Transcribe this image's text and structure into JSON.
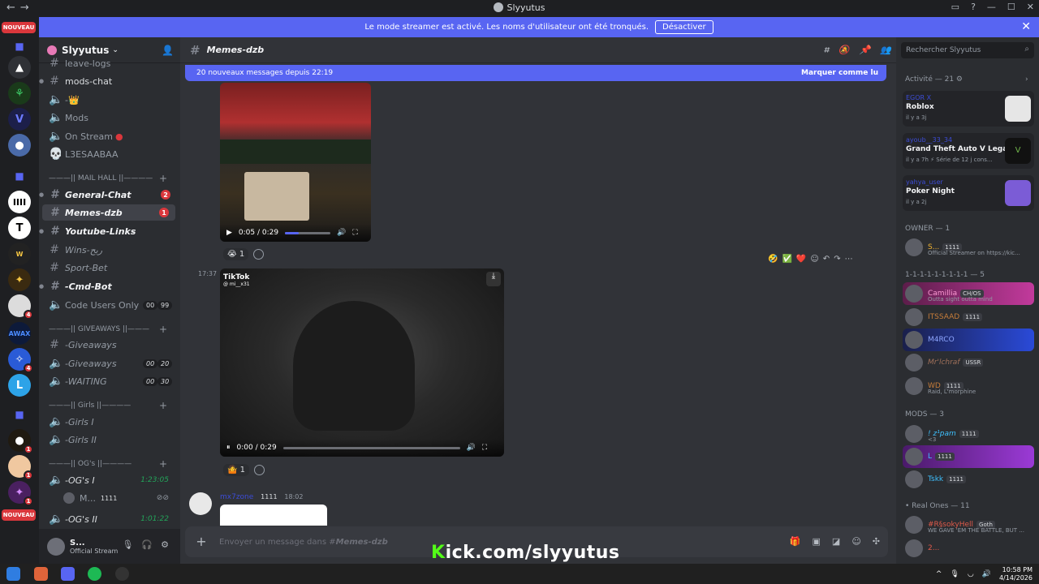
{
  "window": {
    "title": "Slyyutus",
    "nav_back": "←",
    "nav_forward": "→",
    "controls": [
      "▭",
      "?",
      "—",
      "☐",
      "✕"
    ]
  },
  "banner": {
    "text": "Le mode streamer est activé. Les noms d'utilisateur ont été tronqués.",
    "button": "Désactiver",
    "close": "✕"
  },
  "rail": {
    "nouveau_top": "NOUVEAU",
    "nouveau_bottom": "NOUVEAU",
    "badges": [
      "4",
      "4",
      "1",
      "1",
      "1"
    ]
  },
  "server": {
    "name": "Slyyutus",
    "channels": [
      {
        "name": "leave-logs"
      },
      {
        "name": "mods-chat"
      },
      {
        "name": "-👑"
      },
      {
        "name": "Mods"
      },
      {
        "name": "On Stream"
      },
      {
        "name": "L3ESAABAA"
      },
      {
        "name": "General-Chat",
        "count": "2"
      },
      {
        "name": "Memes-dzb",
        "count": "1"
      },
      {
        "name": "Youtube-Links"
      },
      {
        "name": "Wins-ربح"
      },
      {
        "name": "Sport-Bet"
      },
      {
        "name": "-Cmd-Bot"
      },
      {
        "name": "Code Users Only",
        "pill1": "00",
        "pill2": "99"
      },
      {
        "name": "-Giveaways"
      },
      {
        "name": "-Giveaways",
        "pill1": "00",
        "pill2": "20"
      },
      {
        "name": "-WAITING",
        "pill1": "00",
        "pill2": "30"
      },
      {
        "name": "-Girls I"
      },
      {
        "name": "-Girls II"
      },
      {
        "name": "-OG's I",
        "time": "1:23:05"
      },
      {
        "name": "M...",
        "tag": "1111"
      },
      {
        "name": "-OG's II",
        "time": "1:01:22"
      }
    ],
    "categories": [
      "———|| MAIL HALL ||————",
      "———|| GIVEAWAYS ||———",
      "———|| Girls ||————",
      "———|| OG's ||————"
    ]
  },
  "user": {
    "name": "S...",
    "status": "Official Stream"
  },
  "chat": {
    "channel": "Memes-dzb",
    "new_messages": "20 nouveaux messages depuis 22:19",
    "mark_read": "Marquer comme lu",
    "video1": {
      "time": "0:05 / 0:29",
      "progress": 0.3,
      "reaction_emoji": "😭",
      "reaction_count": "1"
    },
    "message2_time": "17:37",
    "video2": {
      "time": "0:00 / 0:29",
      "progress": 0.0,
      "tiktok": "TikTok",
      "tiktok_user": "@ mi__x31",
      "reaction_emoji": "🤷",
      "reaction_count": "1"
    },
    "hover_reactions": [
      "🤣",
      "✅",
      "❤️"
    ],
    "message3": {
      "author": "mx7zone",
      "tag": "1111",
      "time": "18:02"
    },
    "composer_placeholder_prefix": "Envoyer un message dans #",
    "composer_placeholder_channel": "Memes-dzb"
  },
  "members": {
    "search_placeholder": "Rechercher Slyyutus",
    "activity_header": "Activité — 21",
    "activities": [
      {
        "user": "EGOR X",
        "game": "Roblox",
        "time": "il y a 3j"
      },
      {
        "user": "ayoub__33_34",
        "game": "Grand Theft Auto V Legacy",
        "time": "il y a 7h  ⚡ Série de 12 j cons..."
      },
      {
        "user": "yahya_user",
        "game": "Poker Night",
        "time": "il y a 2j"
      }
    ],
    "owner_header": "OWNER — 1",
    "owner": {
      "name": "S...",
      "tag": "1111",
      "sub": "Official Streamer on https://kic..."
    },
    "group_header": "1-1-1-1-1-1-1-1-1 — 5",
    "group": [
      {
        "name": "Camillia",
        "tag": "CH/OS",
        "sub": "Outta sight outta mind"
      },
      {
        "name": "ITSSAAD",
        "tag": "1111"
      },
      {
        "name": "M4RCO"
      },
      {
        "name": "Mr'lchraf",
        "tag": "USSR"
      },
      {
        "name": "WD",
        "tag": "1111",
        "sub": "Raid, L'morphine"
      }
    ],
    "mods_header": "MODS — 3",
    "mods": [
      {
        "name": "! z¹pam",
        "tag": "1111",
        "sub": "<3"
      },
      {
        "name": "L",
        "tag": "1111"
      },
      {
        "name": "Tskk",
        "tag": "1111"
      }
    ],
    "real_header": "• Real Ones — 11",
    "real": [
      {
        "name": "#R§sokyHell",
        "tag": "Goth",
        "sub": "WE GAVE 'EM THE BATTLE, BUT ..."
      },
      {
        "name": "2..."
      }
    ]
  },
  "overlay": {
    "k": "K",
    "rest": "ick.com/slyyutus"
  },
  "taskbar": {
    "time": "10:58 PM",
    "date": "4/14/2026"
  },
  "colors": {
    "blurple": "#5865f2",
    "kick_green": "#53fc18",
    "red": "#da373c",
    "online": "#23a55a"
  }
}
